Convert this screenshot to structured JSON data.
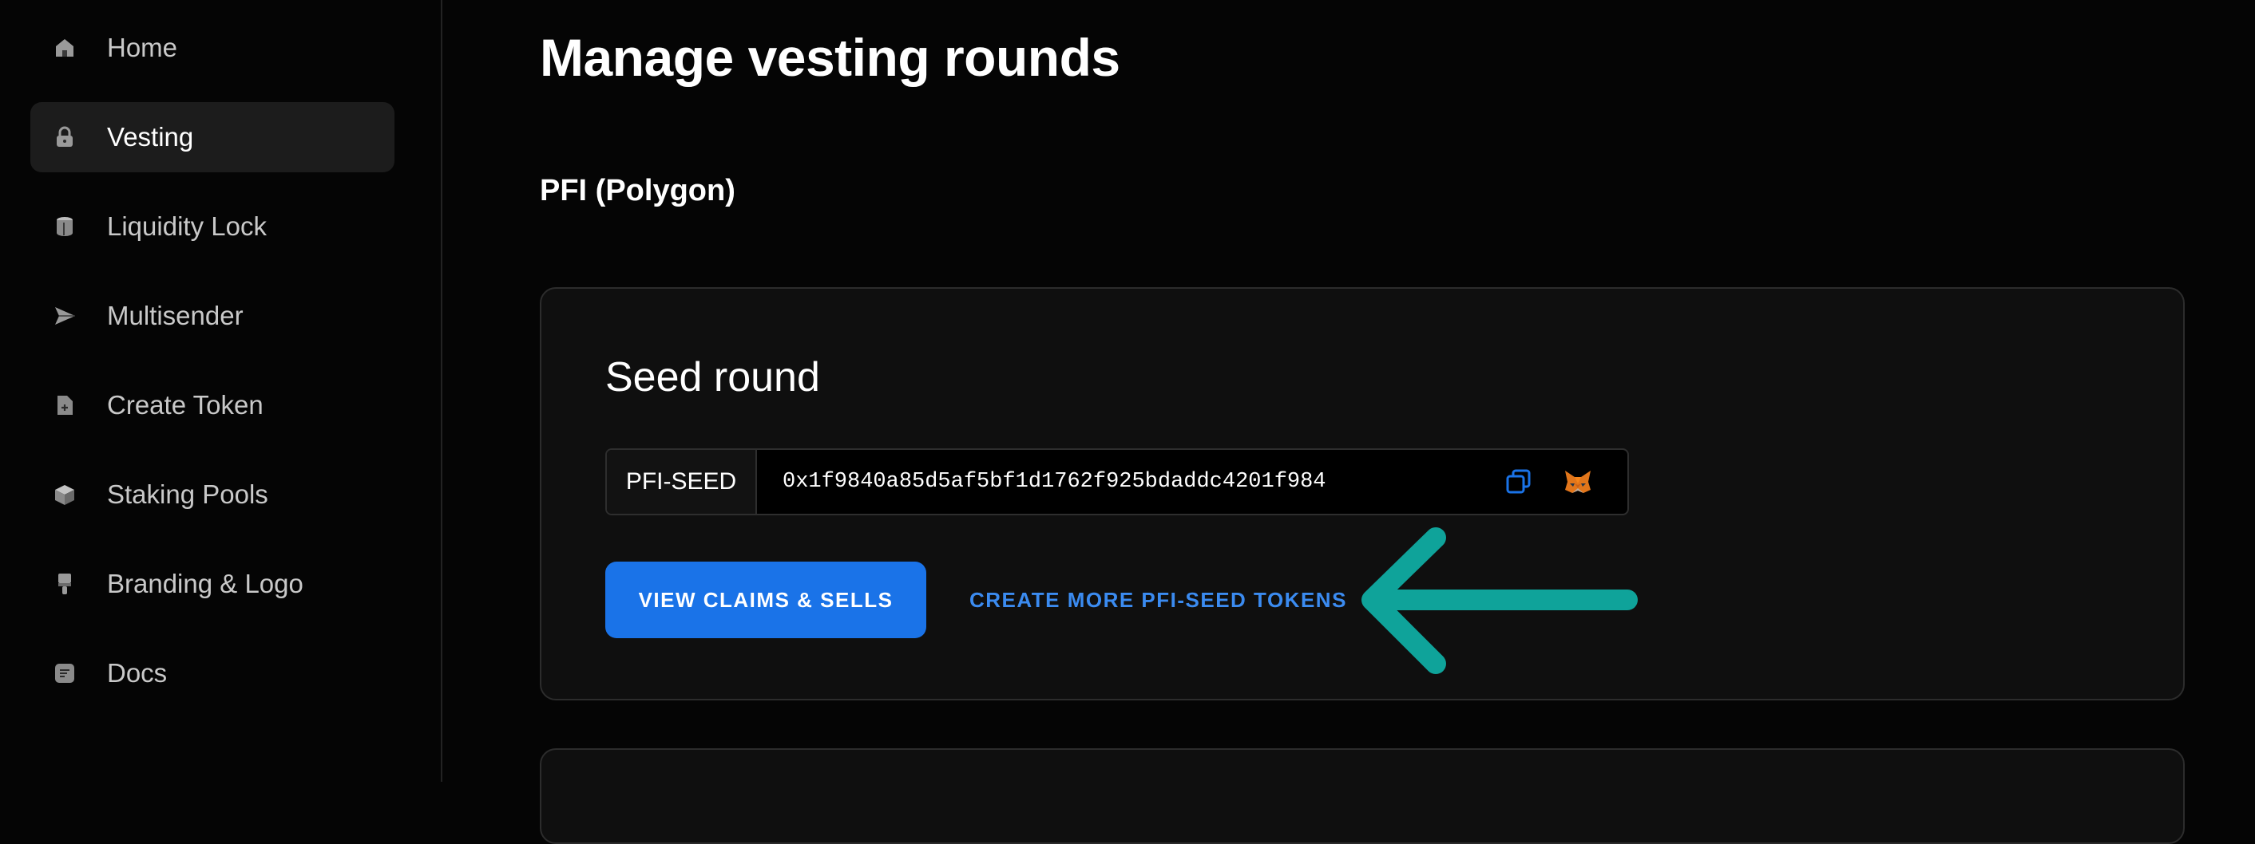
{
  "sidebar": {
    "items": [
      {
        "label": "Home",
        "icon": "home-icon",
        "active": false
      },
      {
        "label": "Vesting",
        "icon": "lock-icon",
        "active": true
      },
      {
        "label": "Liquidity Lock",
        "icon": "cylinder-icon",
        "active": false
      },
      {
        "label": "Multisender",
        "icon": "send-icon",
        "active": false
      },
      {
        "label": "Create Token",
        "icon": "file-plus-icon",
        "active": false
      },
      {
        "label": "Staking Pools",
        "icon": "cube-icon",
        "active": false
      },
      {
        "label": "Branding & Logo",
        "icon": "brush-icon",
        "active": false
      },
      {
        "label": "Docs",
        "icon": "document-icon",
        "active": false
      }
    ]
  },
  "main": {
    "title": "Manage vesting rounds",
    "project_title": "PFI (Polygon)",
    "round": {
      "title": "Seed round",
      "token_symbol": "PFI-SEED",
      "token_address": "0x1f9840a85d5af5bf1d1762f925bdaddc4201f984",
      "copy_icon": "copy-icon",
      "wallet_icon": "metamask-icon",
      "primary_button": "VIEW CLAIMS & SELLS",
      "link_button": "CREATE MORE PFI-SEED TOKENS"
    }
  },
  "colors": {
    "background": "#050505",
    "accent": "#1a73e8",
    "link": "#3b8bf0",
    "annotation_arrow": "#0fa39a"
  }
}
